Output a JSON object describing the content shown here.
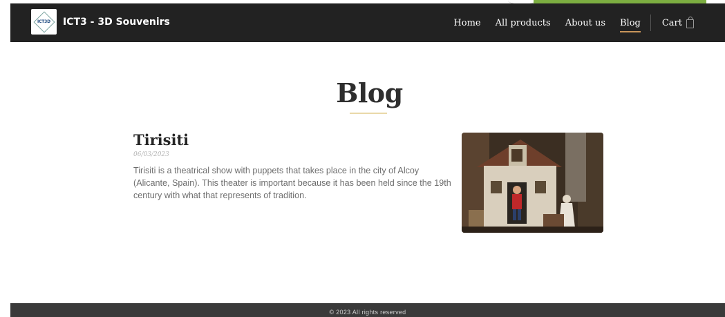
{
  "navbar": {
    "logo_text": "ICT3D",
    "brand": "ICT3 - 3D Souvenirs",
    "links": [
      "Home",
      "All products",
      "About us",
      "Blog"
    ],
    "active": "Blog",
    "cart_label": "Cart",
    "cart_icon": "shopping-bag-icon"
  },
  "page": {
    "title": "Blog"
  },
  "post": {
    "title": "Tirisiti",
    "date": "06/03/2023",
    "body": "Tirisiti is a theatrical show with puppets that takes place in the city of Alcoy (Alicante, Spain). This theater is important because it has been held since the 19th century with what that represents of tradition.",
    "image_subject": "puppet theater scene with a house, a figure in red and a figure in white headscarf"
  },
  "footer": {
    "text": "© 2023 All rights reserved"
  },
  "colors": {
    "nav_bg": "#222222",
    "accent_underline": "#c9955a",
    "footer_bg": "#3a3a3a",
    "corner_green": "#7cae41"
  }
}
